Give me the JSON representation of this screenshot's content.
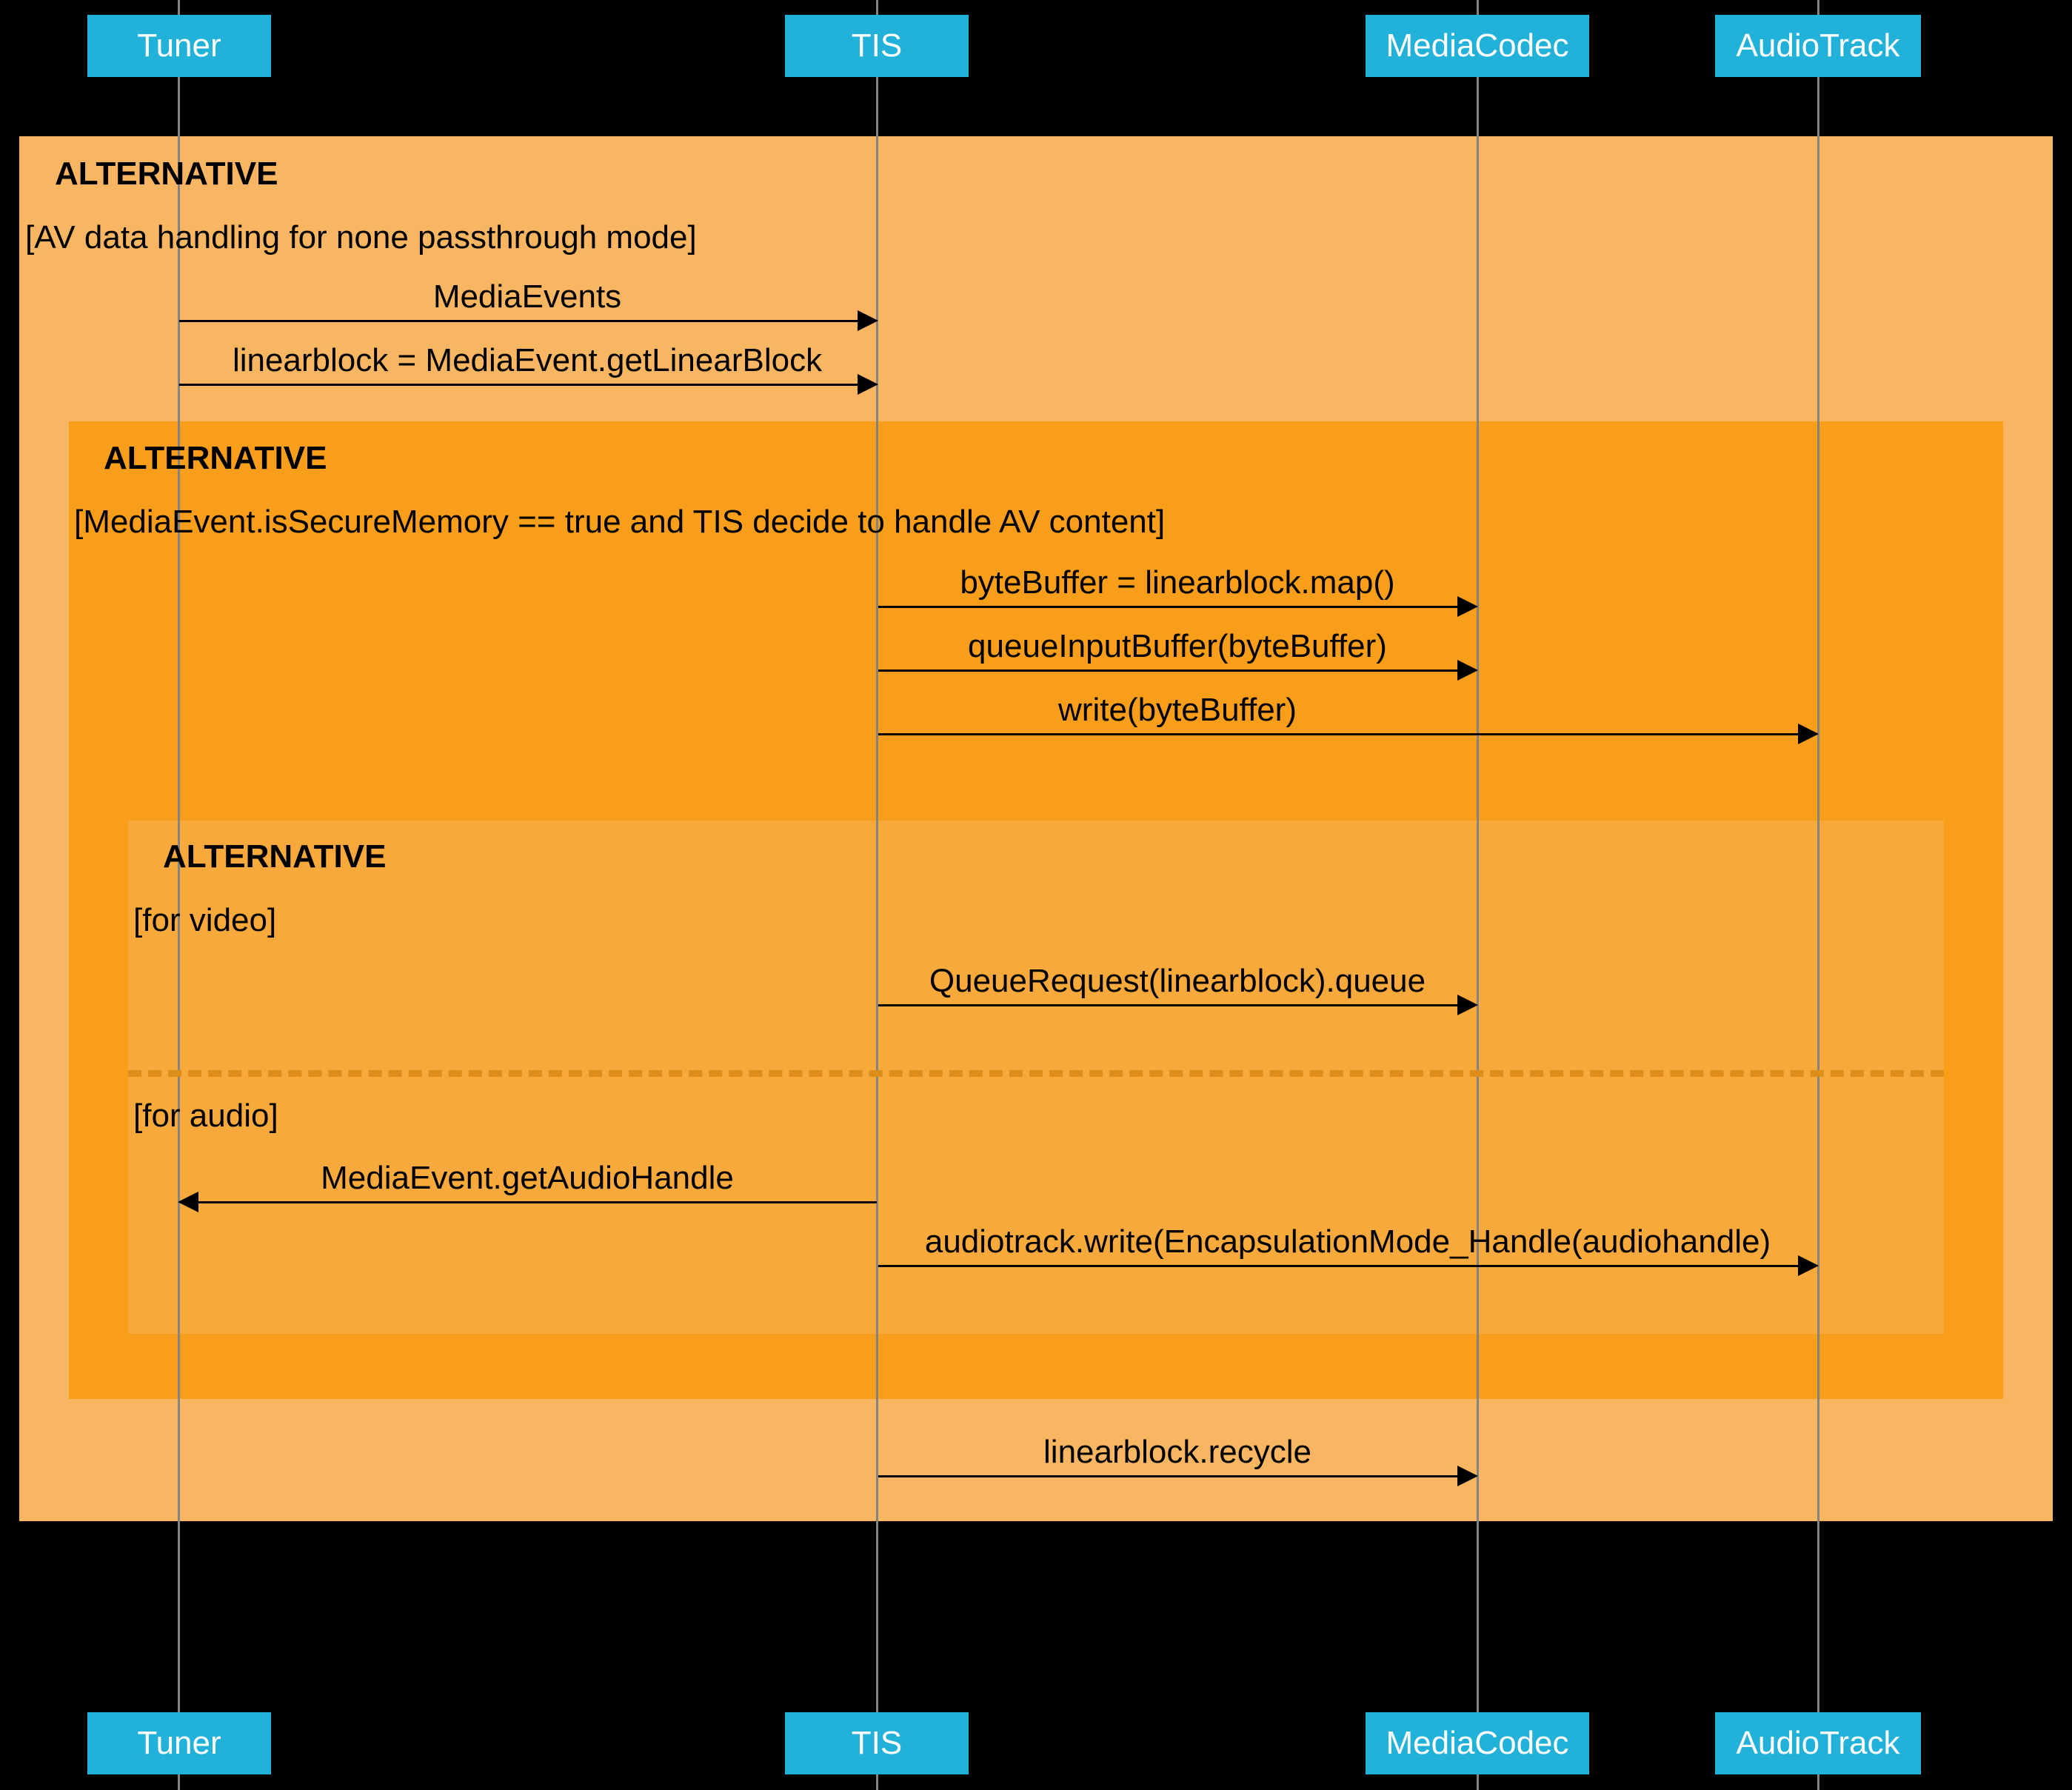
{
  "actors": {
    "tuner": "Tuner",
    "tis": "TIS",
    "mediacodec": "MediaCodec",
    "audiotrack": "AudioTrack"
  },
  "alt1": {
    "label": "ALTERNATIVE",
    "condition": "[AV data handling for none passthrough mode]"
  },
  "alt2": {
    "label": "ALTERNATIVE",
    "condition": "[MediaEvent.isSecureMemory == true and TIS decide to handle AV content]"
  },
  "alt3": {
    "label": "ALTERNATIVE",
    "cond_video": "[for video]",
    "cond_audio": "[for audio]"
  },
  "messages": {
    "m1": "MediaEvents",
    "m2": "linearblock = MediaEvent.getLinearBlock",
    "m3": "byteBuffer = linearblock.map()",
    "m4": "queueInputBuffer(byteBuffer)",
    "m5": "write(byteBuffer)",
    "m6": "QueueRequest(linearblock).queue",
    "m7": "MediaEvent.getAudioHandle",
    "m8": "audiotrack.write(EncapsulationMode_Handle(audiohandle)",
    "m9": "linearblock.recycle"
  }
}
